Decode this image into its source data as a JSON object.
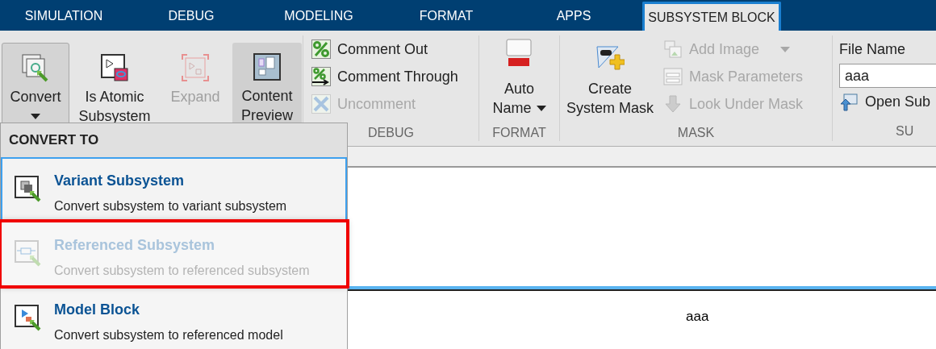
{
  "tabs": [
    {
      "label": "SIMULATION",
      "selected": false
    },
    {
      "label": "DEBUG",
      "selected": false
    },
    {
      "label": "MODELING",
      "selected": false
    },
    {
      "label": "FORMAT",
      "selected": false
    },
    {
      "label": "APPS",
      "selected": false
    },
    {
      "label": "SUBSYSTEM BLOCK",
      "selected": true
    }
  ],
  "ribbon": {
    "main_buttons": [
      {
        "lines": [
          "Convert"
        ],
        "dropdown": true,
        "pressed": true,
        "disabled": false
      },
      {
        "lines": [
          "Is Atomic",
          "Subsystem"
        ],
        "dropdown": false,
        "pressed": false,
        "disabled": false
      },
      {
        "lines": [
          "Expand"
        ],
        "dropdown": false,
        "pressed": false,
        "disabled": true
      },
      {
        "lines": [
          "Content",
          "Preview"
        ],
        "dropdown": false,
        "pressed": true,
        "disabled": false
      }
    ],
    "debug": {
      "label": "DEBUG",
      "items": [
        {
          "label": "Comment Out",
          "disabled": false
        },
        {
          "label": "Comment Through",
          "disabled": false
        },
        {
          "label": "Uncomment",
          "disabled": true
        }
      ]
    },
    "format": {
      "label": "FORMAT",
      "button": {
        "lines": [
          "Auto",
          "Name"
        ],
        "dropdown": true
      }
    },
    "mask": {
      "label": "MASK",
      "button": {
        "lines": [
          "Create",
          "System Mask"
        ]
      },
      "items": [
        {
          "label": "Add Image",
          "disabled": true,
          "dropdown": true
        },
        {
          "label": "Mask Parameters",
          "disabled": true,
          "dropdown": false
        },
        {
          "label": "Look Under Mask",
          "disabled": true,
          "dropdown": false
        }
      ]
    },
    "subsystem": {
      "label": "SU",
      "field_label": "File Name",
      "field_value": "aaa",
      "open_button": "Open Sub"
    }
  },
  "menu": {
    "header": "CONVERT TO",
    "items": [
      {
        "title": "Variant Subsystem",
        "description": "Convert subsystem to variant subsystem",
        "selected": true,
        "disabled": false,
        "highlighted": false
      },
      {
        "title": "Referenced Subsystem",
        "description": "Convert subsystem to referenced subsystem",
        "selected": false,
        "disabled": true,
        "highlighted": true
      },
      {
        "title": "Model Block",
        "description": "Convert subsystem to referenced model",
        "selected": false,
        "disabled": false,
        "highlighted": false
      }
    ]
  },
  "canvas": {
    "block_label": "aaa"
  }
}
